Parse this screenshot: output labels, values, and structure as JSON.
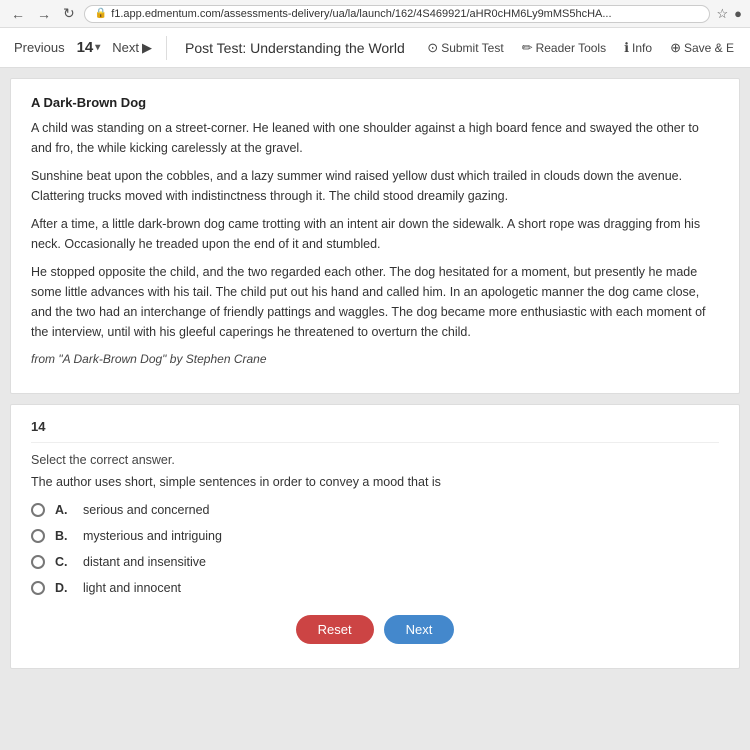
{
  "browser": {
    "url": "f1.app.edmentum.com/assessments-delivery/ua/la/launch/162/4S469921/aHR0cHM6Ly9mMS5hcHA...",
    "lock_icon": "🔒"
  },
  "toolbar": {
    "previous_label": "Previous",
    "question_number": "14",
    "next_label": "Next",
    "next_icon": "▶",
    "title": "Post Test: Understanding the World",
    "submit_label": "Submit Test",
    "reader_label": "Reader Tools",
    "info_label": "Info",
    "save_label": "Save & E",
    "submit_icon": "⊙",
    "reader_icon": "✏",
    "info_icon": "ℹ",
    "save_icon": "⊕"
  },
  "passage": {
    "title": "A Dark-Brown Dog",
    "paragraphs": [
      "A child was standing on a street-corner. He leaned with one shoulder against a high board fence and swayed the other to and fro, the while kicking carelessly at the gravel.",
      "Sunshine beat upon the cobbles, and a lazy summer wind raised yellow dust which trailed in clouds down the avenue. Clattering trucks moved with indistinctness through it. The child stood dreamily gazing.",
      "After a time, a little dark-brown dog came trotting with an intent air down the sidewalk. A short rope was dragging from his neck. Occasionally he treaded upon the end of it and stumbled.",
      "He stopped opposite the child, and the two regarded each other. The dog hesitated for a moment, but presently he made some little advances with his tail. The child put out his hand and called him. In an apologetic manner the dog came close, and the two had an interchange of friendly pattings and waggles. The dog became more enthusiastic with each moment of the interview, until with his gleeful caperings he threatened to overturn the child.",
      "from \"A Dark-Brown Dog\" by Stephen Crane"
    ]
  },
  "question": {
    "number": "14",
    "instruction": "Select the correct answer.",
    "prompt": "The author uses short, simple sentences in order to convey a mood that is",
    "options": [
      {
        "letter": "A.",
        "text": "serious and concerned"
      },
      {
        "letter": "B.",
        "text": "mysterious and intriguing"
      },
      {
        "letter": "C.",
        "text": "distant and insensitive"
      },
      {
        "letter": "D.",
        "text": "light and innocent"
      }
    ]
  },
  "buttons": {
    "reset": "Reset",
    "next": "Next"
  }
}
